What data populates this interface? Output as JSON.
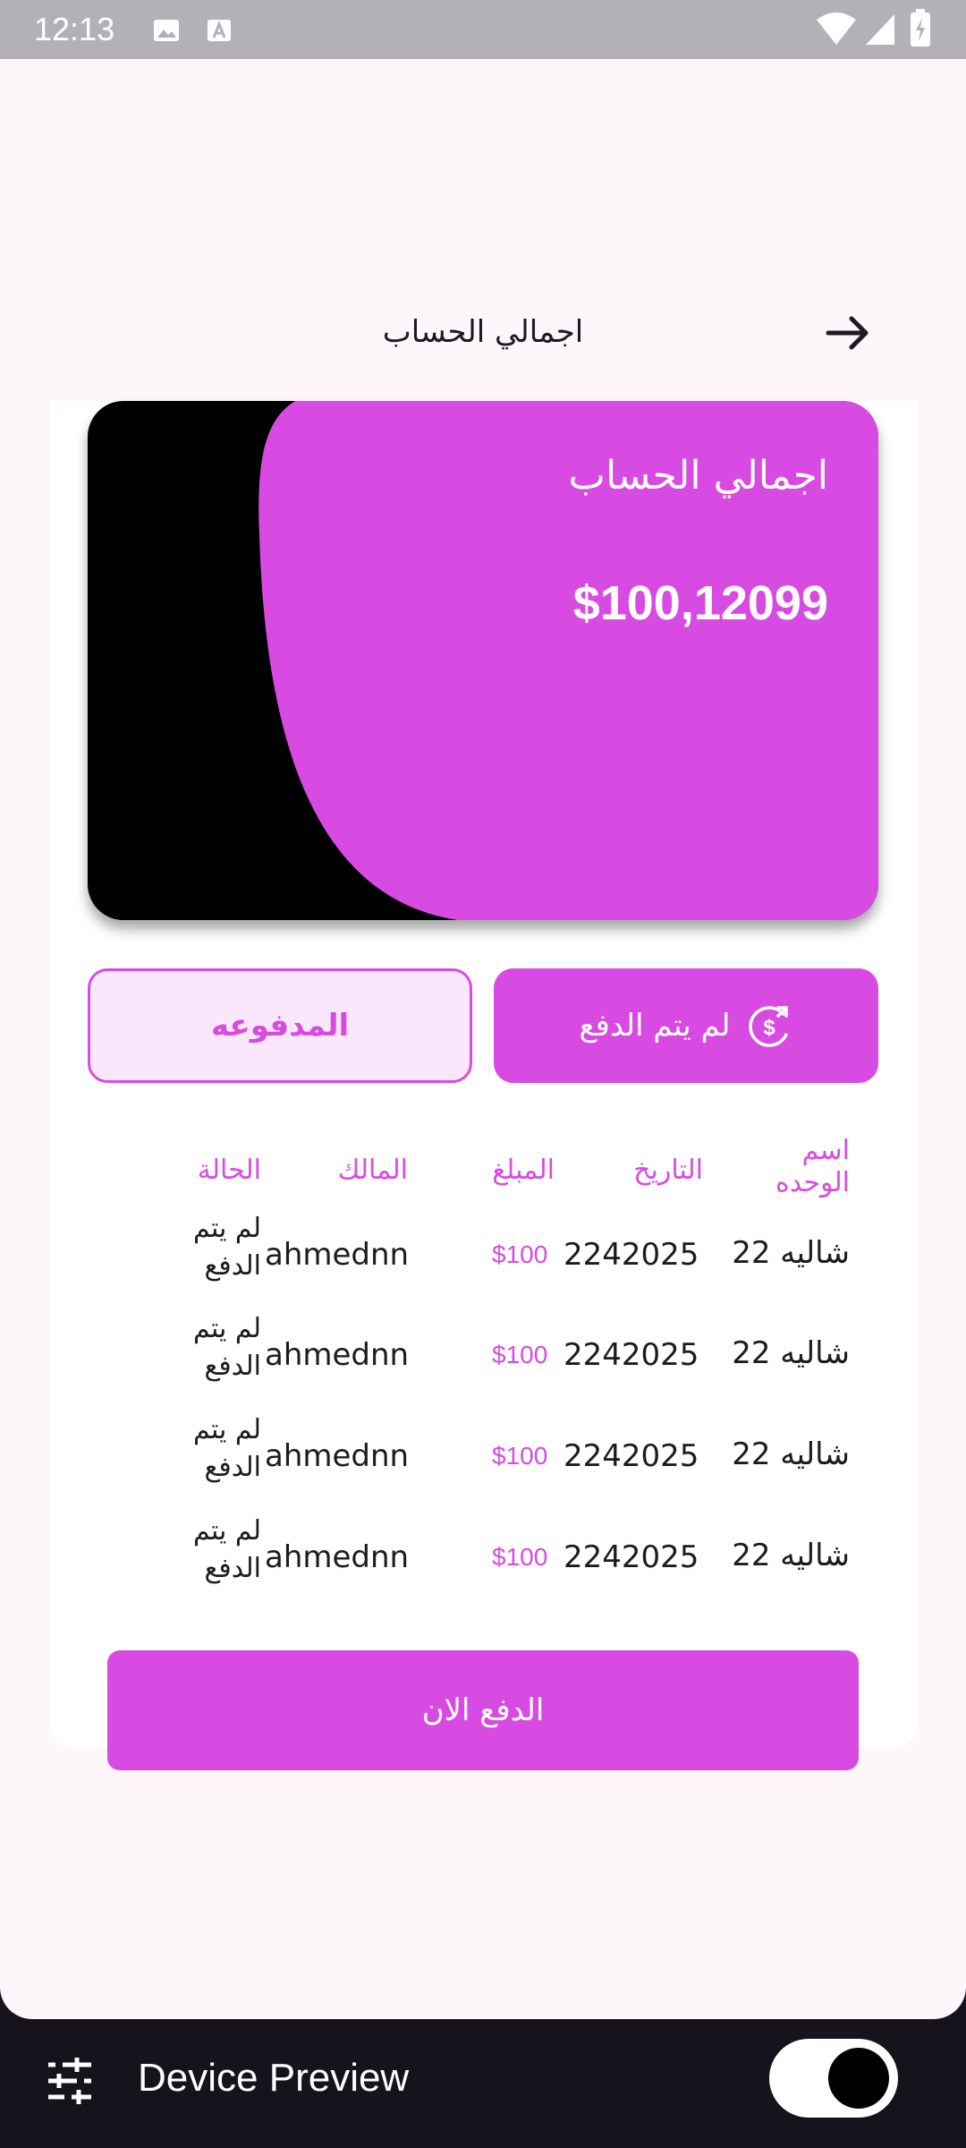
{
  "status_bar": {
    "time": "12:13",
    "icons": [
      "image-icon",
      "font-icon",
      "wifi-icon",
      "signal-icon",
      "battery-icon"
    ]
  },
  "app_bar": {
    "title": "اجمالي  الحساب",
    "back_icon": "arrow-right-icon"
  },
  "summary_card": {
    "title": "اجمالي الحساب",
    "amount": "$100,12099",
    "accent_color": "#d84be3"
  },
  "tabs": {
    "unpaid_label": "لم يتم الدفع",
    "unpaid_icon": "dollar-arrow-icon",
    "paid_label": "المدفوعه"
  },
  "table": {
    "headers": {
      "unit": "اسم الوحده",
      "date": "التاريخ",
      "amount": "المبلغ",
      "owner": "المالك",
      "status": "الحالة"
    },
    "rows": [
      {
        "unit": "شاليه 22",
        "date": "2242025",
        "amount": "$100",
        "owner": "ahmednn",
        "status": "لم يتم الدفع"
      },
      {
        "unit": "شاليه 22",
        "date": "2242025",
        "amount": "$100",
        "owner": "ahmednn",
        "status": "لم يتم الدفع"
      },
      {
        "unit": "شاليه 22",
        "date": "2242025",
        "amount": "$100",
        "owner": "ahmednn",
        "status": "لم يتم الدفع"
      },
      {
        "unit": "شاليه 22",
        "date": "2242025",
        "amount": "$100",
        "owner": "ahmednn",
        "status": "لم يتم الدفع"
      }
    ]
  },
  "pay_button": {
    "label": "الدفع الان"
  },
  "device_preview": {
    "label": "Device Preview",
    "toggle_on": true,
    "settings_icon": "tune-icon"
  }
}
